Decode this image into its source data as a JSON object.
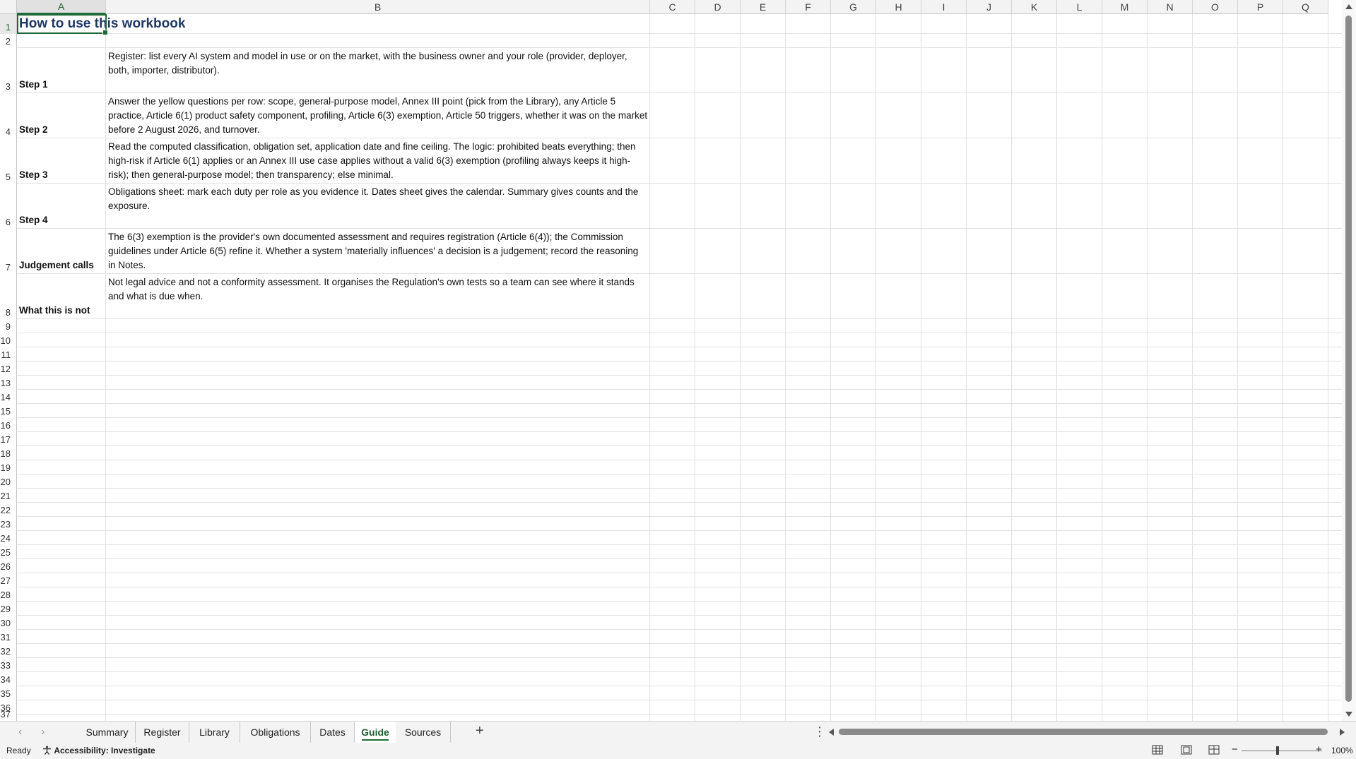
{
  "columns": [
    "A",
    "B",
    "C",
    "D",
    "E",
    "F",
    "G",
    "H",
    "I",
    "J",
    "K",
    "L",
    "M",
    "N",
    "O",
    "P",
    "Q"
  ],
  "active_column": "A",
  "rows": [
    "1",
    "2",
    "3",
    "4",
    "5",
    "6",
    "7",
    "8",
    "9",
    "10",
    "11",
    "12",
    "13",
    "14",
    "15",
    "16",
    "17",
    "18",
    "19",
    "20",
    "21",
    "22",
    "23",
    "24",
    "25",
    "26",
    "27",
    "28",
    "29",
    "30",
    "31",
    "32",
    "33",
    "34",
    "35",
    "36",
    "37"
  ],
  "active_row": "1",
  "sheet": {
    "title": "How to use this workbook",
    "steps": [
      {
        "label": "Step 1",
        "text": "Register: list every AI system and model in use or on the market, with the business owner and your role (provider, deployer, both, importer, distributor)."
      },
      {
        "label": "Step 2",
        "text": "Answer the yellow questions per row: scope, general-purpose model, Annex III point (pick from the Library), any Article 5 practice, Article 6(1) product safety component, profiling, Article 6(3) exemption, Article 50 triggers, whether it was on the market before 2 August 2026, and turnover."
      },
      {
        "label": "Step 3",
        "text": "Read the computed classification, obligation set, application date and fine ceiling. The logic: prohibited beats everything; then high-risk if Article 6(1) applies or an Annex III use case applies without a valid 6(3) exemption (profiling always keeps it high-risk); then general-purpose model; then transparency; else minimal."
      },
      {
        "label": "Step 4",
        "text": "Obligations sheet: mark each duty per role as you evidence it. Dates sheet gives the calendar. Summary gives counts and the exposure."
      },
      {
        "label": "Judgement calls",
        "text": "The 6(3) exemption is the provider's own documented assessment and requires registration (Article 6(4)); the Commission guidelines under Article 6(5) refine it. Whether a system 'materially influences' a decision is a judgement; record the reasoning in Notes."
      },
      {
        "label": "What this is not",
        "text": "Not legal advice and not a conformity assessment. It organises the Regulation's own tests so a team can see where it stands and what is due when."
      }
    ]
  },
  "tabs": [
    "Summary",
    "Register",
    "Library",
    "Obligations",
    "Dates",
    "Guide",
    "Sources"
  ],
  "active_tab": "Guide",
  "add_sheet_icon": "+",
  "more_icon": "⋮",
  "status": {
    "ready": "Ready",
    "accessibility": "Accessibility: Investigate",
    "zoom_out": "−",
    "zoom_in": "+",
    "zoom": "100%"
  },
  "colors": {
    "accent": "#1d6b3a",
    "title": "#1f3864"
  }
}
